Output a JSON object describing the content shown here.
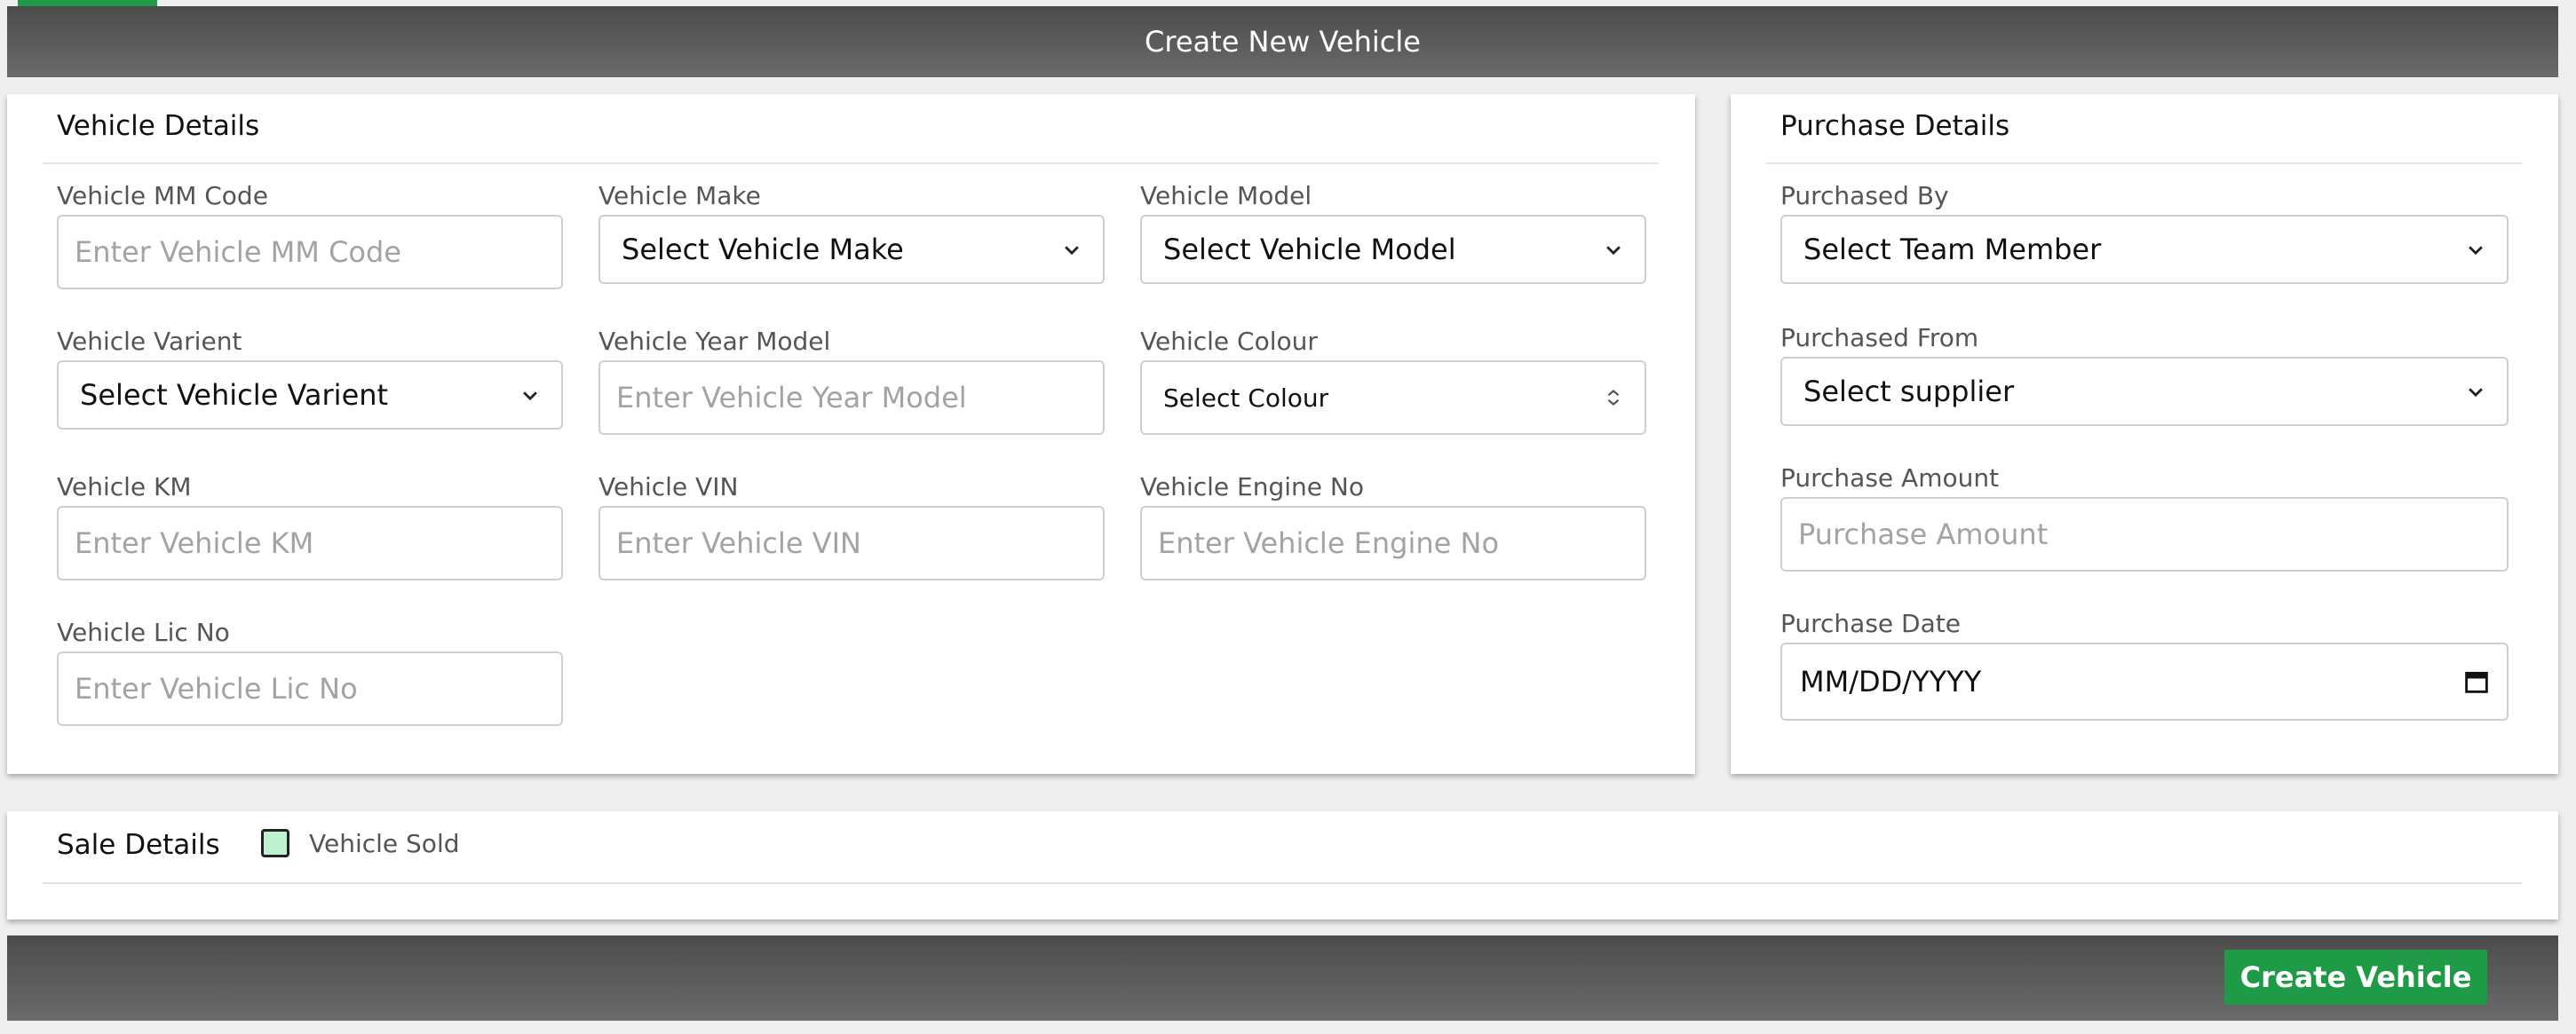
{
  "header": {
    "title": "Create New Vehicle"
  },
  "vehicle_details": {
    "title": "Vehicle Details",
    "mm_code": {
      "label": "Vehicle MM Code",
      "placeholder": "Enter Vehicle MM Code"
    },
    "make": {
      "label": "Vehicle Make",
      "selected": "Select Vehicle Make"
    },
    "model": {
      "label": "Vehicle Model",
      "selected": "Select Vehicle Model"
    },
    "varient": {
      "label": "Vehicle Varient",
      "selected": "Select Vehicle Varient"
    },
    "year_model": {
      "label": "Vehicle Year Model",
      "placeholder": "Enter Vehicle Year Model"
    },
    "colour": {
      "label": "Vehicle Colour",
      "selected": "Select Colour"
    },
    "km": {
      "label": "Vehicle KM",
      "placeholder": "Enter Vehicle KM"
    },
    "vin": {
      "label": "Vehicle VIN",
      "placeholder": "Enter Vehicle VIN"
    },
    "engine_no": {
      "label": "Vehicle Engine No",
      "placeholder": "Enter Vehicle Engine No"
    },
    "lic_no": {
      "label": "Vehicle Lic No",
      "placeholder": "Enter Vehicle Lic No"
    }
  },
  "purchase_details": {
    "title": "Purchase Details",
    "purchased_by": {
      "label": "Purchased By",
      "selected": "Select Team Member"
    },
    "purchased_from": {
      "label": "Purchased From",
      "selected": "Select supplier"
    },
    "amount": {
      "label": "Purchase Amount",
      "placeholder": "Purchase Amount"
    },
    "date": {
      "label": "Purchase Date",
      "value": "MM/DD/YYYY"
    }
  },
  "sale_details": {
    "title": "Sale Details",
    "sold_label": "Vehicle Sold",
    "sold_checked": false
  },
  "footer": {
    "create_label": "Create Vehicle"
  },
  "colors": {
    "accent": "#1f9a46",
    "bar_dark": "#4c4c4c",
    "checkbox_fill": "#bff0cf"
  },
  "icons": [
    "chevron-down-icon",
    "sort-arrows-icon",
    "calendar-icon"
  ]
}
